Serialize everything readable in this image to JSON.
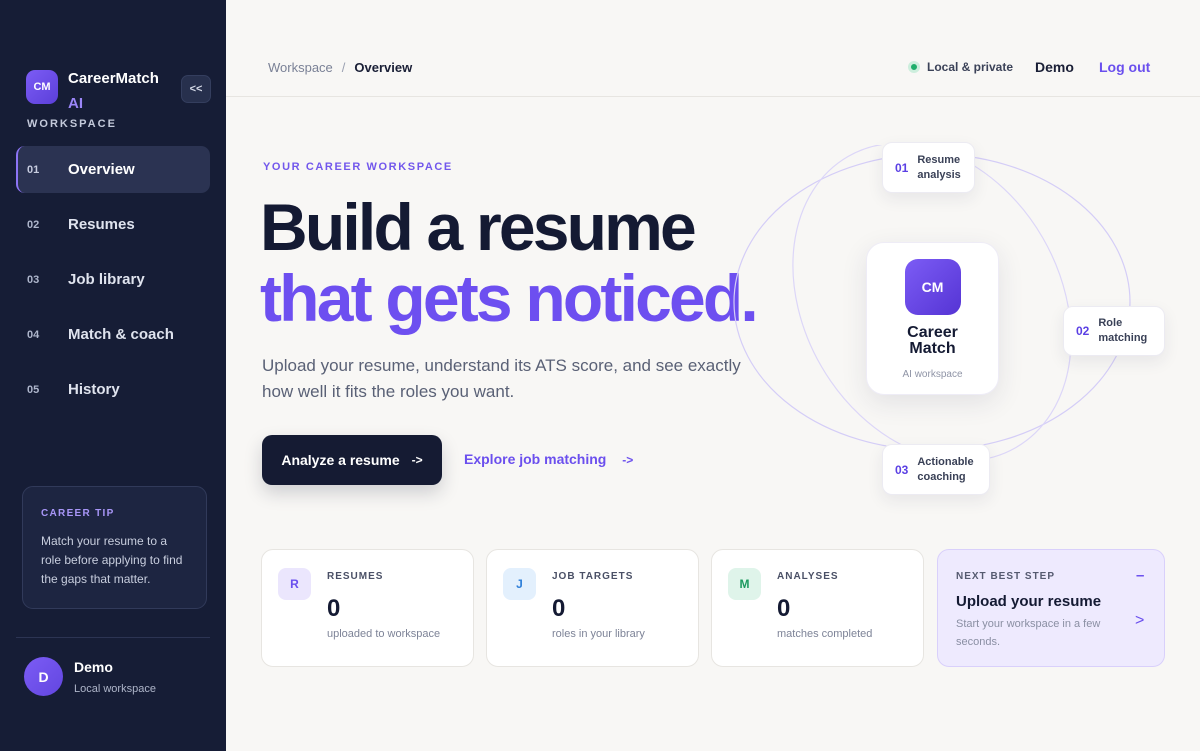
{
  "sidebar": {
    "logo_text": "CM",
    "brand_name": "CareerMatch",
    "brand_suffix": "AI",
    "collapse_label": "<<",
    "section_label": "WORKSPACE",
    "nav": [
      {
        "num": "01",
        "label": "Overview",
        "active": true
      },
      {
        "num": "02",
        "label": "Resumes",
        "active": false
      },
      {
        "num": "03",
        "label": "Job library",
        "active": false
      },
      {
        "num": "04",
        "label": "Match & coach",
        "active": false
      },
      {
        "num": "05",
        "label": "History",
        "active": false
      }
    ],
    "tip": {
      "title": "CAREER TIP",
      "text": "Match your resume to a role before applying to find the gaps that matter."
    },
    "user": {
      "initial": "D",
      "name": "Demo",
      "subtitle": "Local workspace"
    }
  },
  "topbar": {
    "breadcrumb": [
      "Workspace",
      "Overview"
    ],
    "breadcrumb_separator": "/",
    "status": "Local & private",
    "status_color": "#1fae6b",
    "user": "Demo",
    "logout": "Log out"
  },
  "hero": {
    "eyebrow": "YOUR CAREER WORKSPACE",
    "title_line1": "Build a resume",
    "title_line2": "that gets noticed.",
    "lead": "Upload your resume, understand its ATS score, and see exactly how well it fits the roles you want.",
    "primary_cta": "Analyze a resume",
    "primary_cta_arrow": "->",
    "secondary_cta": "Explore job matching",
    "secondary_cta_arrow": "->",
    "accent_color": "#6d4ff0"
  },
  "orbit": {
    "center_logo": "CM",
    "center_title_1": "Career",
    "center_title_2": "Match",
    "center_sub": "AI workspace",
    "steps": [
      {
        "num": "01",
        "line1": "Resume",
        "line2": "analysis"
      },
      {
        "num": "02",
        "line1": "Role",
        "line2": "matching"
      },
      {
        "num": "03",
        "line1": "Actionable",
        "line2": "coaching"
      }
    ]
  },
  "stats": [
    {
      "icon": "R",
      "label": "RESUMES",
      "value": "0",
      "sub": "uploaded to workspace",
      "icon_bg": "#ebe6fd",
      "icon_color": "#6a4fee"
    },
    {
      "icon": "J",
      "label": "JOB TARGETS",
      "value": "0",
      "sub": "roles in your library",
      "icon_bg": "#e3f0fd",
      "icon_color": "#2f7fd9"
    },
    {
      "icon": "M",
      "label": "ANALYSES",
      "value": "0",
      "sub": "matches completed",
      "icon_bg": "#dff4ea",
      "icon_color": "#1c9a5f"
    }
  ],
  "next_step": {
    "label": "NEXT BEST STEP",
    "dash": "–",
    "title": "Upload your resume",
    "sub": "Start your workspace in a few seconds.",
    "arrow": ">"
  }
}
